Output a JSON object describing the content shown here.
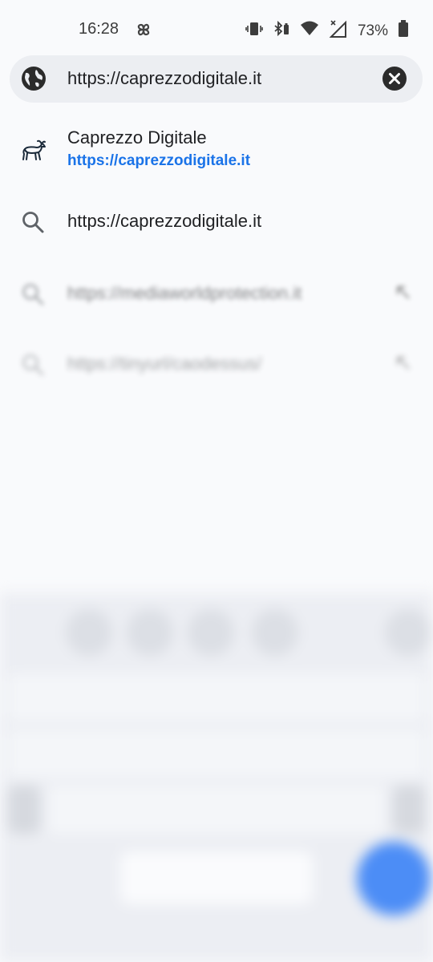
{
  "status_bar": {
    "time": "16:28",
    "battery_percent": "73%",
    "icons": [
      "pinwheel-icon",
      "vibrate-icon",
      "bluetooth-battery-icon",
      "wifi-icon",
      "cellular-no-signal-icon",
      "battery-icon"
    ]
  },
  "address_bar": {
    "value": "https://caprezzodigitale.it",
    "icon": "globe-icon",
    "clear_icon": "clear-icon"
  },
  "suggestions": [
    {
      "title": "Caprezzo Digitale",
      "url": "https://caprezzodigitale.it",
      "icon": "site-favicon-goat"
    },
    {
      "text": "https://caprezzodigitale.it",
      "icon": "search-icon"
    },
    {
      "text": "https://mediaworldprotection.it",
      "icon": "search-icon",
      "action_icon": "arrow-up-left-icon"
    },
    {
      "text": "https://tinyurl/caodessus/",
      "icon": "search-icon",
      "action_icon": "arrow-up-left-icon"
    }
  ],
  "colors": {
    "accent_link": "#1a73e8",
    "background": "#f9fafc",
    "address_bar_bg": "#eceef2",
    "keyboard_fab": "#4c8df6"
  }
}
